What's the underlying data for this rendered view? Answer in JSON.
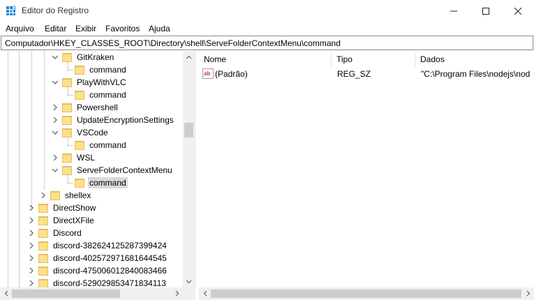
{
  "window": {
    "title": "Editor do Registro",
    "controls": {
      "minimize": "—",
      "maximize": "☐",
      "close": "✕"
    }
  },
  "menu": [
    "Arquivo",
    "Editar",
    "Exibir",
    "Favoritos",
    "Ajuda"
  ],
  "address": "Computador\\HKEY_CLASSES_ROOT\\Directory\\shell\\ServeFolderContextMenu\\command",
  "tree": {
    "items": [
      {
        "label": "GitKraken",
        "expander": "expanded"
      },
      {
        "label": "command",
        "expander": "none"
      },
      {
        "label": "PlayWithVLC",
        "expander": "expanded"
      },
      {
        "label": "command",
        "expander": "none"
      },
      {
        "label": "Powershell",
        "expander": "collapsed"
      },
      {
        "label": "UpdateEncryptionSettings",
        "expander": "collapsed"
      },
      {
        "label": "VSCode",
        "expander": "expanded"
      },
      {
        "label": "command",
        "expander": "none"
      },
      {
        "label": "WSL",
        "expander": "collapsed"
      },
      {
        "label": "ServeFolderContextMenu",
        "expander": "expanded"
      },
      {
        "label": "command",
        "expander": "none",
        "selected": true
      },
      {
        "label": "shellex",
        "expander": "collapsed"
      },
      {
        "label": "DirectShow",
        "expander": "collapsed"
      },
      {
        "label": "DirectXFile",
        "expander": "collapsed"
      },
      {
        "label": "Discord",
        "expander": "collapsed"
      },
      {
        "label": "discord-382624125287399424",
        "expander": "collapsed"
      },
      {
        "label": "discord-402572971681644545",
        "expander": "collapsed"
      },
      {
        "label": "discord-475006012840083466",
        "expander": "collapsed"
      },
      {
        "label": "discord-529029853471834113",
        "expander": "collapsed"
      }
    ]
  },
  "list": {
    "columns": [
      "Nome",
      "Tipo",
      "Dados"
    ],
    "rows": [
      {
        "name": "(Padrão)",
        "type": "REG_SZ",
        "data": "\"C:\\Program Files\\nodejs\\nod",
        "icon": "string-value-icon"
      }
    ]
  },
  "colors": {
    "folder": "#ffe08a",
    "selection": "#d9d9d9",
    "scrollbar": "#f0f0f0",
    "thumb": "#cdcdcd",
    "icon_ab": "#d33b2c"
  }
}
